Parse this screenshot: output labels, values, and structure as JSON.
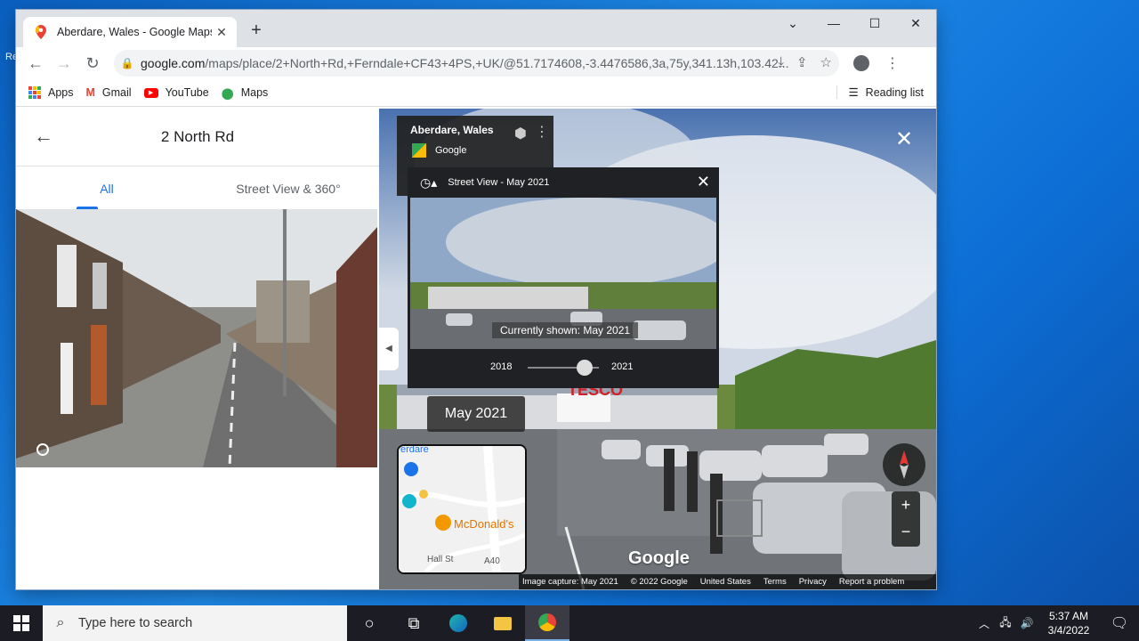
{
  "browser": {
    "tab_title": "Aberdare, Wales - Google Maps",
    "url_host": "google.com",
    "url_rest": "/maps/place/2+North+Rd,+Ferndale+CF43+4PS,+UK/@51.7174608,-3.4476586,3a,75y,341.13h,103.42...",
    "bookmarks": [
      "Apps",
      "Gmail",
      "YouTube",
      "Maps"
    ],
    "reading_list": "Reading list"
  },
  "sidepanel": {
    "title": "2 North Rd",
    "tabs": [
      "All",
      "Street View & 360°"
    ]
  },
  "streetview": {
    "place": "Aberdare, Wales",
    "provider": "Google",
    "timetravel_title": "Street View - May 2021",
    "currently_shown": "Currently shown: May 2021",
    "slider_start": "2018",
    "slider_end": "2021",
    "slider_position": 0.8,
    "date_badge": "May 2021",
    "watermark": "Google",
    "minimap_labels": [
      "erdare",
      "McDonald's",
      "Hall St",
      "A40"
    ],
    "footer": [
      "Image capture: May 2021",
      "© 2022 Google",
      "United States",
      "Terms",
      "Privacy",
      "Report a problem"
    ],
    "store_sign": "TESCO"
  },
  "taskbar": {
    "search_placeholder": "Type here to search",
    "time": "5:37 AM",
    "date": "3/4/2022"
  }
}
